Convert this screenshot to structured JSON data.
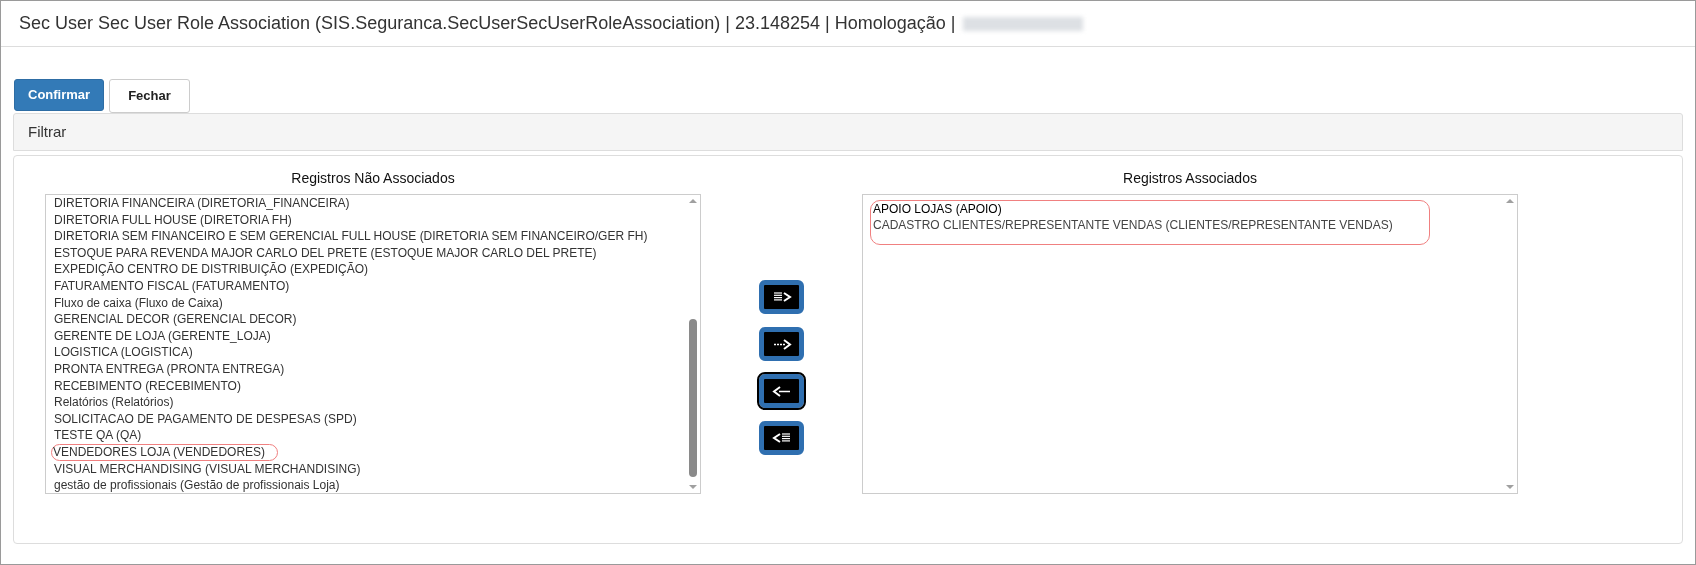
{
  "window": {
    "title": "Sec User Sec User Role Association (SIS.Seguranca.SecUserSecUserRoleAssociation) | 23.148254 | Homologação |"
  },
  "toolbar": [
    {
      "label": "Confirmar",
      "kind": "primary"
    },
    {
      "label": "Fechar",
      "kind": "default"
    }
  ],
  "filter": {
    "label": "Filtrar"
  },
  "unassociated": {
    "title": "Registros Não Associados",
    "items": [
      {
        "text": "DIRETORIA FINANCEIRA (DIRETORIA_FINANCEIRA)",
        "circled": false
      },
      {
        "text": "DIRETORIA FULL HOUSE (DIRETORIA FH)",
        "circled": false
      },
      {
        "text": "DIRETORIA SEM FINANCEIRO E SEM GERENCIAL FULL HOUSE (DIRETORIA SEM FINANCEIRO/GER FH)",
        "circled": false
      },
      {
        "text": "ESTOQUE PARA REVENDA MAJOR CARLO DEL PRETE (ESTOQUE MAJOR CARLO DEL PRETE)",
        "circled": false
      },
      {
        "text": "EXPEDIÇÃO CENTRO DE DISTRIBUIÇÃO (EXPEDIÇÃO)",
        "circled": false
      },
      {
        "text": "FATURAMENTO FISCAL (FATURAMENTO)",
        "circled": false
      },
      {
        "text": "Fluxo de caixa (Fluxo de Caixa)",
        "circled": false
      },
      {
        "text": "GERENCIAL DECOR (GERENCIAL DECOR)",
        "circled": false
      },
      {
        "text": "GERENTE DE LOJA (GERENTE_LOJA)",
        "circled": false
      },
      {
        "text": "LOGISTICA (LOGISTICA)",
        "circled": false
      },
      {
        "text": "PRONTA ENTREGA (PRONTA ENTREGA)",
        "circled": false
      },
      {
        "text": "RECEBIMENTO (RECEBIMENTO)",
        "circled": false
      },
      {
        "text": "Relatórios (Relatórios)",
        "circled": false
      },
      {
        "text": "SOLICITACAO DE PAGAMENTO DE DESPESAS (SPD)",
        "circled": false
      },
      {
        "text": "TESTE QA (QA)",
        "circled": false
      },
      {
        "text": "VENDEDORES LOJA (VENDEDORES)",
        "circled": true
      },
      {
        "text": "VISUAL MERCHANDISING (VISUAL MERCHANDISING)",
        "circled": false
      },
      {
        "text": "gestão de profissionais (Gestão de profissionais Loja)",
        "circled": false
      }
    ]
  },
  "move_buttons": [
    {
      "kind": "all-right",
      "focused": false
    },
    {
      "kind": "right",
      "focused": false
    },
    {
      "kind": "left",
      "focused": true
    },
    {
      "kind": "all-left",
      "focused": false
    }
  ],
  "associated": {
    "title": "Registros Associados",
    "circled": true,
    "items": [
      {
        "text": "APOIO LOJAS (APOIO)",
        "dark": true
      },
      {
        "text": "CADASTRO CLIENTES/REPRESENTANTE VENDAS (CLIENTES/REPRESENTANTE VENDAS)",
        "dark": false
      }
    ]
  }
}
